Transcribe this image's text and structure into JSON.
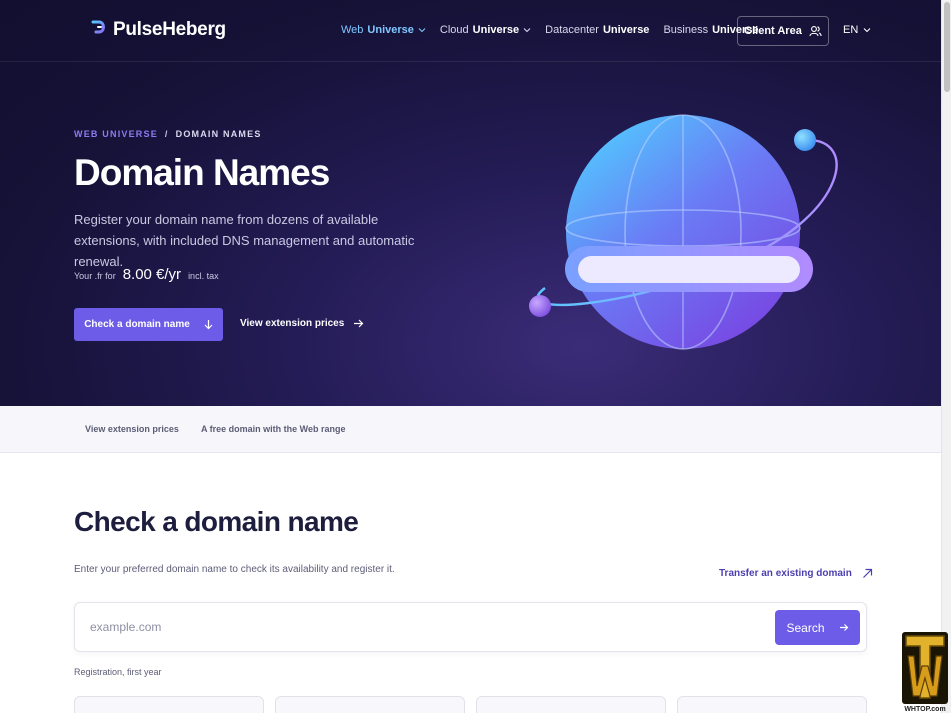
{
  "brand": {
    "name": "PulseHeberg",
    "accent": "#6c5ce7",
    "link_blue": "#7fc7ff"
  },
  "nav": {
    "items": [
      {
        "pre": "Web",
        "bold": "Universe",
        "dropdown": true,
        "active": true
      },
      {
        "pre": "Cloud",
        "bold": "Universe",
        "dropdown": true,
        "active": false
      },
      {
        "pre": "Datacenter",
        "bold": "Universe",
        "dropdown": false,
        "active": false
      },
      {
        "pre": "Business",
        "bold": "Universe",
        "dropdown": false,
        "active": false
      }
    ],
    "client_area": "Client Area",
    "client_icon": "users-icon",
    "language": "EN"
  },
  "hero": {
    "breadcrumb": {
      "parent": "WEB UNIVERSE",
      "separator": "/",
      "current": "DOMAIN NAMES"
    },
    "title": "Domain Names",
    "description": "Register your domain name from dozens of available extensions, with included DNS management and automatic renewal.",
    "price": {
      "prefix": "Your .fr for",
      "value": "8.00 €/yr",
      "suffix": "incl. tax"
    },
    "primary_cta": "Check a domain name",
    "secondary_cta": "View extension prices"
  },
  "subnav": {
    "items": [
      "View extension prices",
      "A free domain with the Web range"
    ]
  },
  "check": {
    "title": "Check a domain name",
    "description": "Enter your preferred domain name to check its availability and register it.",
    "transfer_link": "Transfer an existing domain",
    "search_placeholder": "example.com",
    "search_button": "Search",
    "registration_label": "Registration, first year"
  },
  "watermark": {
    "text": "WHTOP.com"
  }
}
